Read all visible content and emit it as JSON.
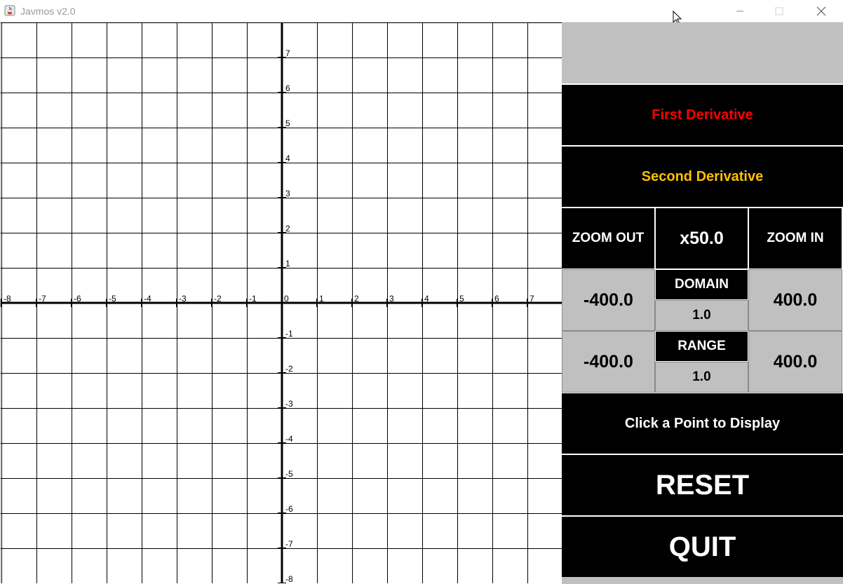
{
  "window": {
    "title": "Javmos v2.0",
    "icons": [
      "java-app-icon",
      "minimize-icon",
      "maximize-icon",
      "close-icon"
    ]
  },
  "graph": {
    "x_ticks": [
      "-8",
      "-7",
      "-6",
      "-5",
      "-4",
      "-3",
      "-2",
      "-1",
      "0",
      "1",
      "2",
      "3",
      "4",
      "5",
      "6",
      "7"
    ],
    "y_ticks_positive": [
      "7",
      "6",
      "5",
      "4",
      "3",
      "2",
      "1"
    ],
    "y_ticks_negative": [
      "-1",
      "-2",
      "-3",
      "-4",
      "-5",
      "-6",
      "-7",
      "-8"
    ]
  },
  "panel": {
    "first_derivative": "First Derivative",
    "second_derivative": "Second Derivative",
    "zoom_out": "ZOOM OUT",
    "zoom_level": "x50.0",
    "zoom_in": "ZOOM IN",
    "domain_label": "DOMAIN",
    "domain_min": "-400.0",
    "domain_step": "1.0",
    "domain_max": "400.0",
    "range_label": "RANGE",
    "range_min": "-400.0",
    "range_step": "1.0",
    "range_max": "400.0",
    "point_display": "Click a Point to Display",
    "reset": "RESET",
    "quit": "QUIT"
  },
  "colors": {
    "first_derivative": "#ff0000",
    "second_derivative": "#ffc000",
    "panel_black": "#000000",
    "panel_grey": "#c0c0c0"
  }
}
